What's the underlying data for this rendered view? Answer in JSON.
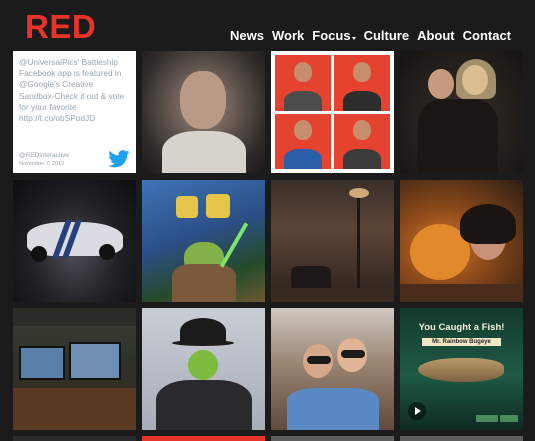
{
  "header": {
    "logo": "RED",
    "nav": [
      {
        "label": "News"
      },
      {
        "label": "Work"
      },
      {
        "label": "Focus",
        "has_dropdown": true
      },
      {
        "label": "Culture"
      },
      {
        "label": "About"
      },
      {
        "label": "Contact"
      }
    ]
  },
  "tweet": {
    "text": "@UniversalPics' Battleship Facebook app is featured in @Google's Creative Sandbox-Check it out & vote for your favorite http://t.co/obSPodJD",
    "handle": "@REDinteractive",
    "date": "November 7, 2012",
    "icon": "twitter-bird-icon"
  },
  "fish_promo": {
    "title": "You Caught a Fish!",
    "subtitle": "Mr. Rainbow Bugeye"
  },
  "colors": {
    "brand_red": "#e8332a",
    "background": "#1b1b1b",
    "twitter_blue": "#1da1f2"
  }
}
